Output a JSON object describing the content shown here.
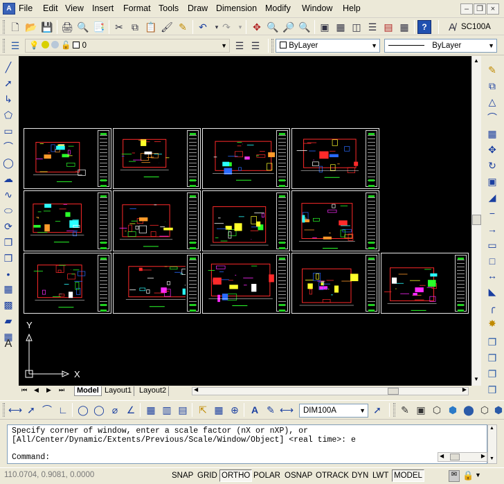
{
  "menu": [
    "File",
    "Edit",
    "View",
    "Insert",
    "Format",
    "Tools",
    "Draw",
    "Dimension",
    "Modify",
    "Window",
    "Help"
  ],
  "toolbar": {
    "layer_value": "0",
    "color_value": "ByLayer",
    "linetype_value": "ByLayer",
    "textstyle_value": "SC100A",
    "dimstyle_value": "DIM100A"
  },
  "tabs": [
    "Model",
    "Layout1",
    "Layout2"
  ],
  "ucs": {
    "x_label": "X",
    "y_label": "Y"
  },
  "command": {
    "line1": "Specify corner of window, enter a scale factor (nX or nXP), or",
    "line2": "[All/Center/Dynamic/Extents/Previous/Scale/Window/Object] <real time>: e",
    "prompt": "Command:"
  },
  "status": {
    "coords": "110.0704, 0.9081, 0.0000",
    "toggles": [
      "SNAP",
      "GRID",
      "ORTHO",
      "POLAR",
      "OSNAP",
      "OTRACK",
      "DYN",
      "LWT",
      "MODEL"
    ]
  },
  "colors": {
    "canvas": "#000000",
    "accent": "#1fd11f"
  }
}
